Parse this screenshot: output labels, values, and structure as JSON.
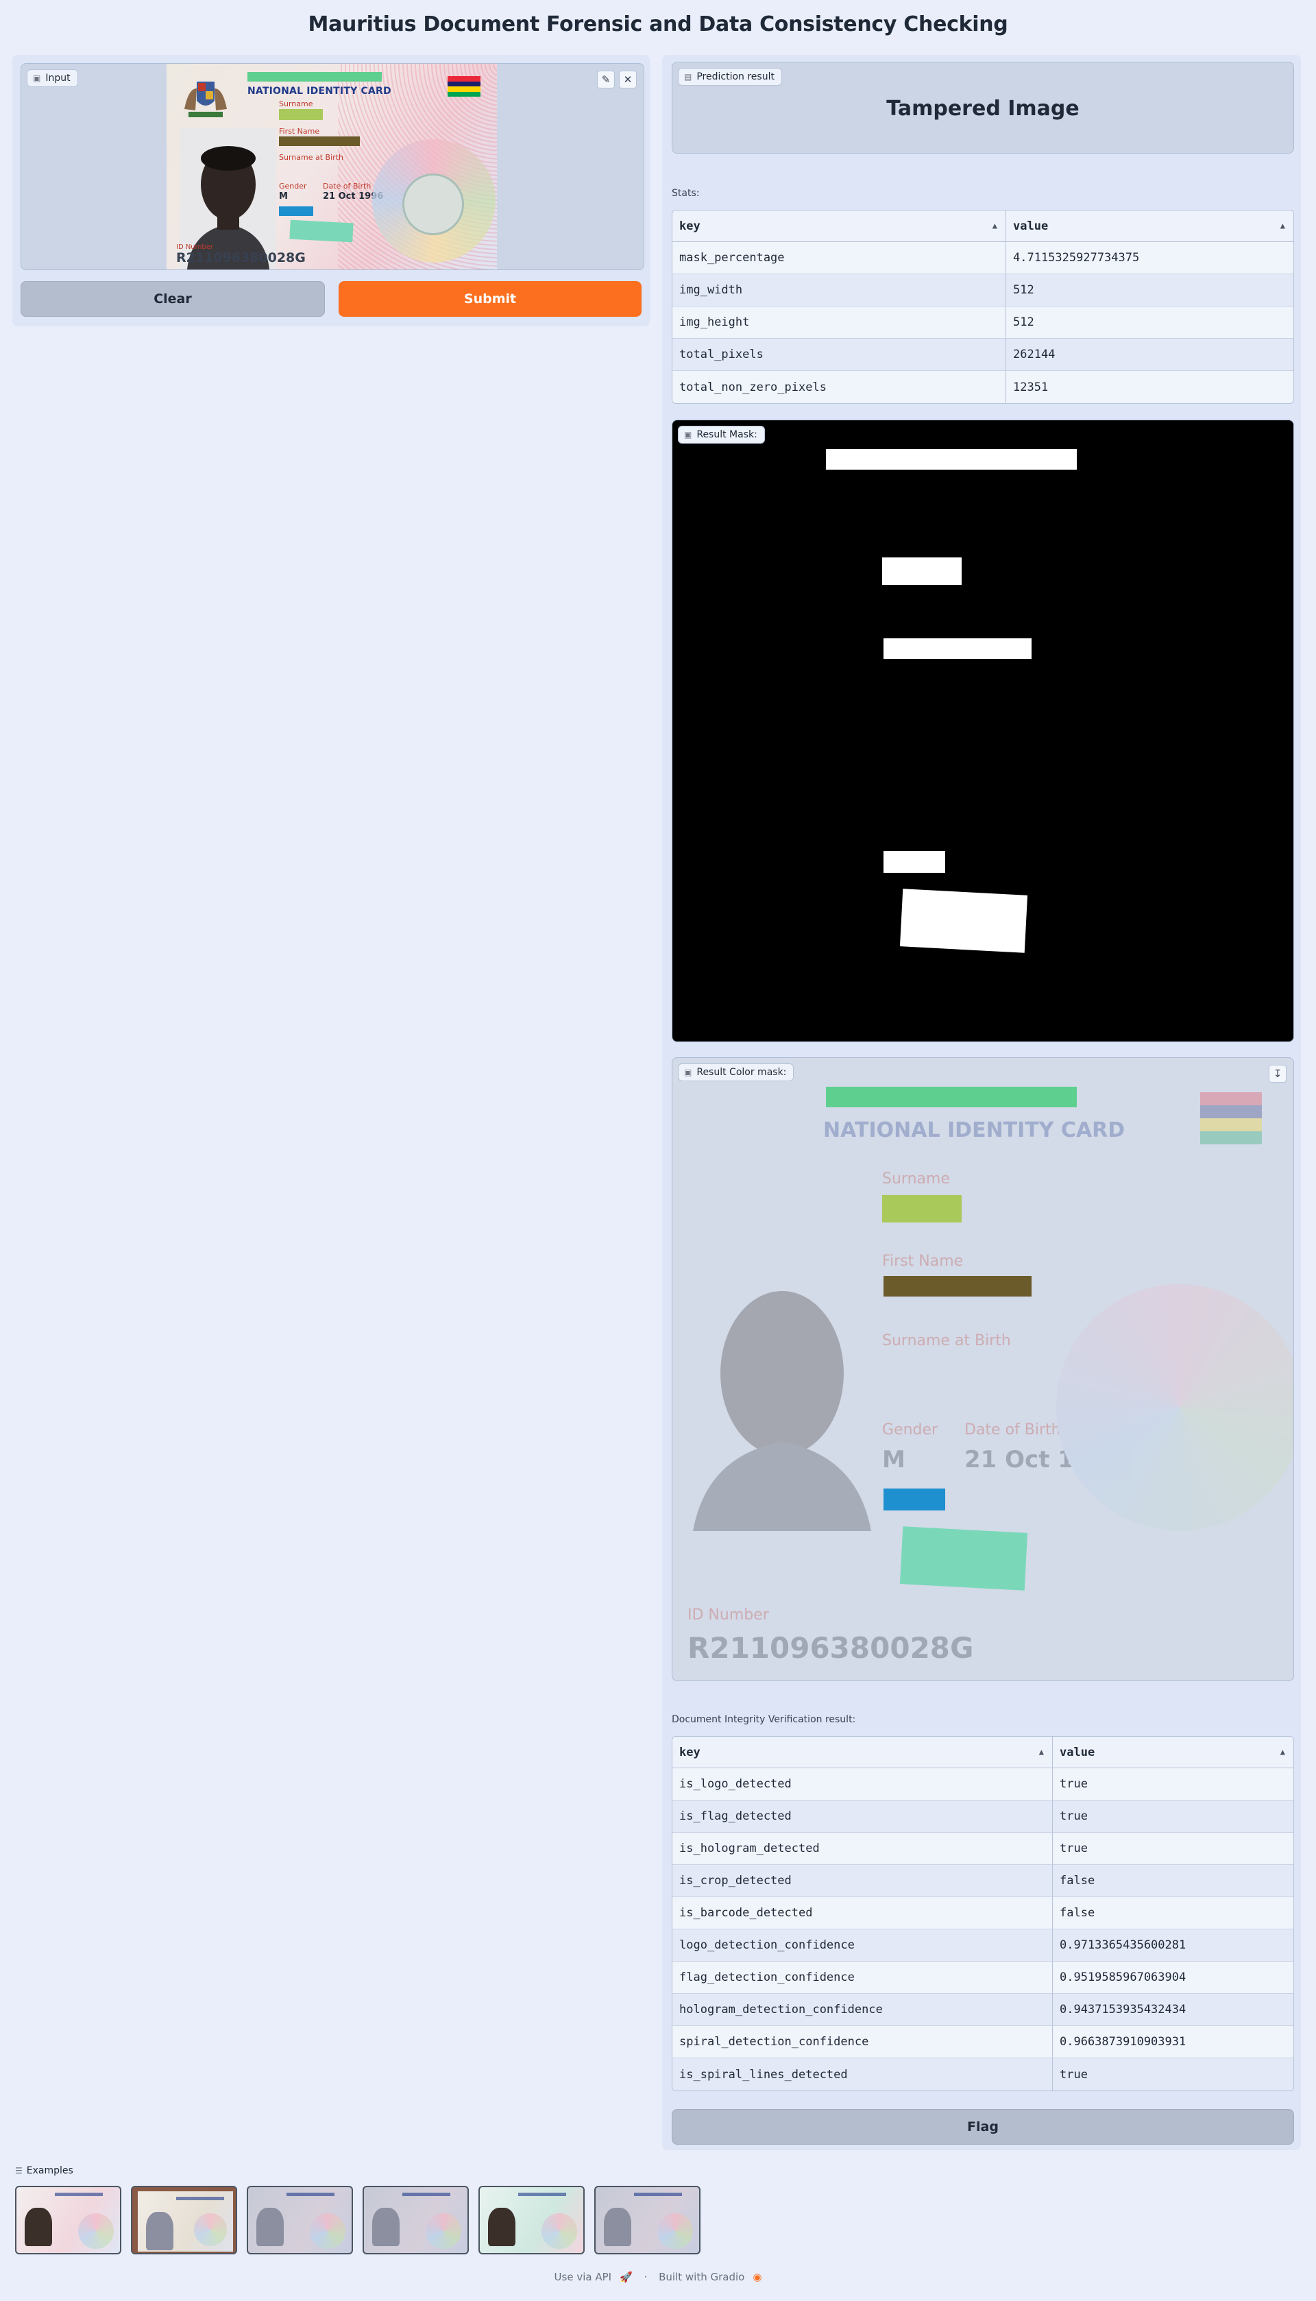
{
  "page": {
    "title": "Mauritius Document Forensic and Data Consistency Checking"
  },
  "input": {
    "label": "Input",
    "card": {
      "title": "NATIONAL IDENTITY CARD",
      "surname_label": "Surname",
      "first_name_label": "First Name",
      "surname_birth_label": "Surname at Birth",
      "gender_label": "Gender",
      "gender_value": "M",
      "dob_label": "Date of Birth",
      "dob_value": "21 Oct 1996",
      "id_label": "ID Number",
      "id_value": "R211096380028G"
    },
    "edit_icon": "pencil-icon",
    "close_icon": "close-icon"
  },
  "buttons": {
    "clear": "Clear",
    "submit": "Submit",
    "flag": "Flag"
  },
  "prediction": {
    "label": "Prediction result",
    "value": "Tampered Image"
  },
  "stats": {
    "caption": "Stats:",
    "headers": [
      "key",
      "value"
    ],
    "rows": [
      [
        "mask_percentage",
        "4.7115325927734375"
      ],
      [
        "img_width",
        "512"
      ],
      [
        "img_height",
        "512"
      ],
      [
        "total_pixels",
        "262144"
      ],
      [
        "total_non_zero_pixels",
        "12351"
      ]
    ]
  },
  "result_mask": {
    "label": "Result Mask:"
  },
  "result_color_mask": {
    "label": "Result Color mask:",
    "download_icon": "download-icon"
  },
  "integrity": {
    "caption": "Document Integrity Verification result:",
    "headers": [
      "key",
      "value"
    ],
    "rows": [
      [
        "is_logo_detected",
        "true"
      ],
      [
        "is_flag_detected",
        "true"
      ],
      [
        "is_hologram_detected",
        "true"
      ],
      [
        "is_crop_detected",
        "false"
      ],
      [
        "is_barcode_detected",
        "false"
      ],
      [
        "logo_detection_confidence",
        "0.9713365435600281"
      ],
      [
        "flag_detection_confidence",
        "0.9519585967063904"
      ],
      [
        "hologram_detection_confidence",
        "0.9437153935432434"
      ],
      [
        "spiral_detection_confidence",
        "0.9663873910903931"
      ],
      [
        "is_spiral_lines_detected",
        "true"
      ]
    ]
  },
  "examples": {
    "label": "Examples",
    "count": 6
  },
  "footer": {
    "api": "Use via API",
    "separator": "·",
    "built": "Built with Gradio"
  },
  "colors": {
    "submit": "#fb6f1f",
    "patch_green": "#5fcf8f",
    "patch_olive": "#a9c95a",
    "patch_brown": "#6b5a2a",
    "patch_blue": "#1e8fcf",
    "patch_teal": "#7ad8b8"
  }
}
